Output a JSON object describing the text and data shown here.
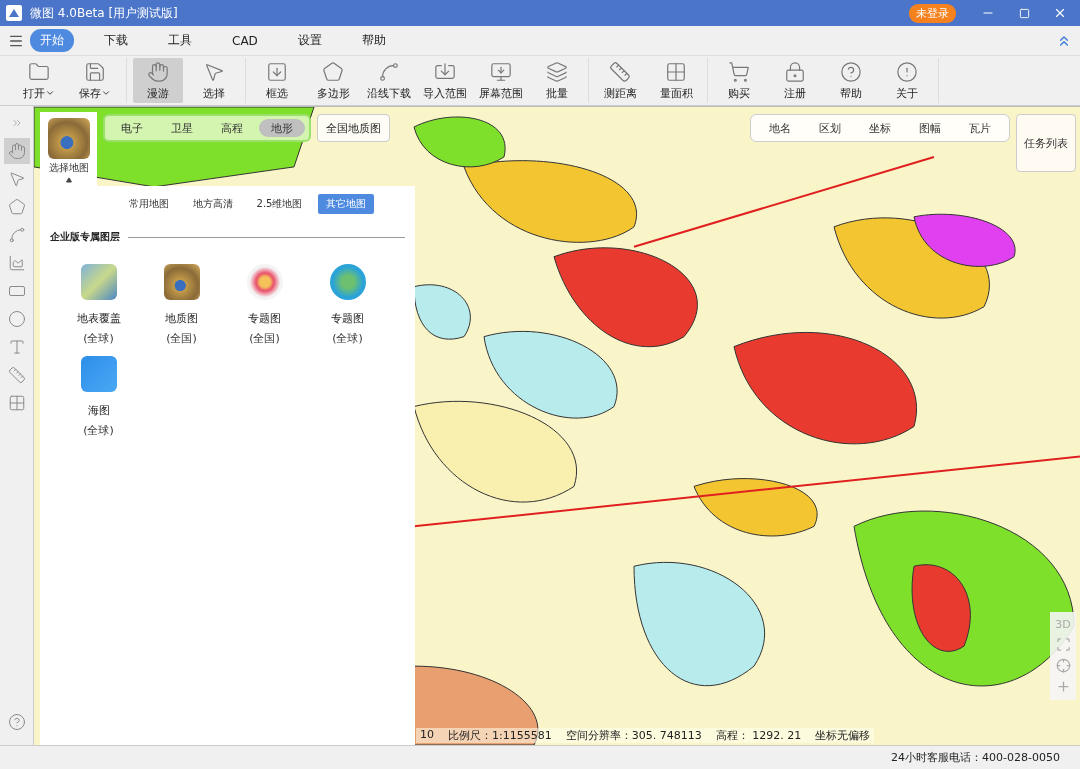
{
  "window": {
    "title": "微图 4.0Beta [用户测试版]",
    "login_badge": "未登录"
  },
  "menu": [
    {
      "label": "开始",
      "selected": true
    },
    {
      "label": "下载",
      "selected": false
    },
    {
      "label": "工具",
      "selected": false
    },
    {
      "label": "CAD",
      "selected": false
    },
    {
      "label": "设置",
      "selected": false
    },
    {
      "label": "帮助",
      "selected": false
    }
  ],
  "ribbon": [
    [
      {
        "label": "打开",
        "dropdown": true,
        "selected": false
      },
      {
        "label": "保存",
        "dropdown": true,
        "selected": false
      }
    ],
    [
      {
        "label": "漫游",
        "dropdown": false,
        "selected": true
      },
      {
        "label": "选择",
        "dropdown": false,
        "selected": false
      }
    ],
    [
      {
        "label": "框选",
        "dropdown": false,
        "selected": false
      },
      {
        "label": "多边形",
        "dropdown": false,
        "selected": false
      },
      {
        "label": "沿线下载",
        "dropdown": false,
        "selected": false
      },
      {
        "label": "导入范围",
        "dropdown": false,
        "selected": false
      },
      {
        "label": "屏幕范围",
        "dropdown": false,
        "selected": false
      },
      {
        "label": "批量",
        "dropdown": false,
        "selected": false
      }
    ],
    [
      {
        "label": "测距离",
        "dropdown": false,
        "selected": false
      },
      {
        "label": "量面积",
        "dropdown": false,
        "selected": false
      }
    ],
    [
      {
        "label": "购买",
        "dropdown": false,
        "selected": false
      },
      {
        "label": "注册",
        "dropdown": false,
        "selected": false
      },
      {
        "label": "帮助",
        "dropdown": false,
        "selected": false
      },
      {
        "label": "关于",
        "dropdown": false,
        "selected": false
      }
    ]
  ],
  "left_tools": [
    {
      "selected": false
    },
    {
      "selected": true
    },
    {
      "selected": false
    },
    {
      "selected": false
    },
    {
      "selected": false
    },
    {
      "selected": false
    },
    {
      "selected": false
    },
    {
      "selected": false
    },
    {
      "selected": false
    },
    {
      "selected": false
    },
    {
      "selected": false
    }
  ],
  "map_panel": {
    "selector_label": "选择地图",
    "base_tabs": [
      {
        "label": "电子",
        "selected": false
      },
      {
        "label": "卫星",
        "selected": false
      },
      {
        "label": "高程",
        "selected": false
      },
      {
        "label": "地形",
        "selected": true
      }
    ],
    "extra_button": "全国地质图",
    "sub_tabs": [
      {
        "label": "常用地图",
        "selected": false
      },
      {
        "label": "地方高清",
        "selected": false
      },
      {
        "label": "2.5维地图",
        "selected": false
      },
      {
        "label": "其它地图",
        "selected": true
      }
    ],
    "section_title": "企业版专属图层",
    "items": [
      {
        "name": "地表覆盖",
        "scope": "(全球)",
        "kind": "landcover"
      },
      {
        "name": "地质图",
        "scope": "(全国)",
        "kind": "geology"
      },
      {
        "name": "专题图",
        "scope": "(全国)",
        "kind": "china"
      },
      {
        "name": "专题图",
        "scope": "(全球)",
        "kind": "globe"
      },
      {
        "name": "海图",
        "scope": "(全球)",
        "kind": "chart"
      }
    ]
  },
  "overlay_tabs": [
    "地名",
    "区划",
    "坐标",
    "图幅",
    "瓦片"
  ],
  "task_button": "任务列表",
  "map_controls": {
    "three_d": "3D"
  },
  "map_status": {
    "level": "10",
    "scale": "比例尺：1:1155581",
    "resolution": "空间分辨率：305. 748113",
    "elevation": "高程：  1292. 21",
    "offset": "坐标无偏移"
  },
  "status_bar": "24小时客服电话：400-028-0050"
}
